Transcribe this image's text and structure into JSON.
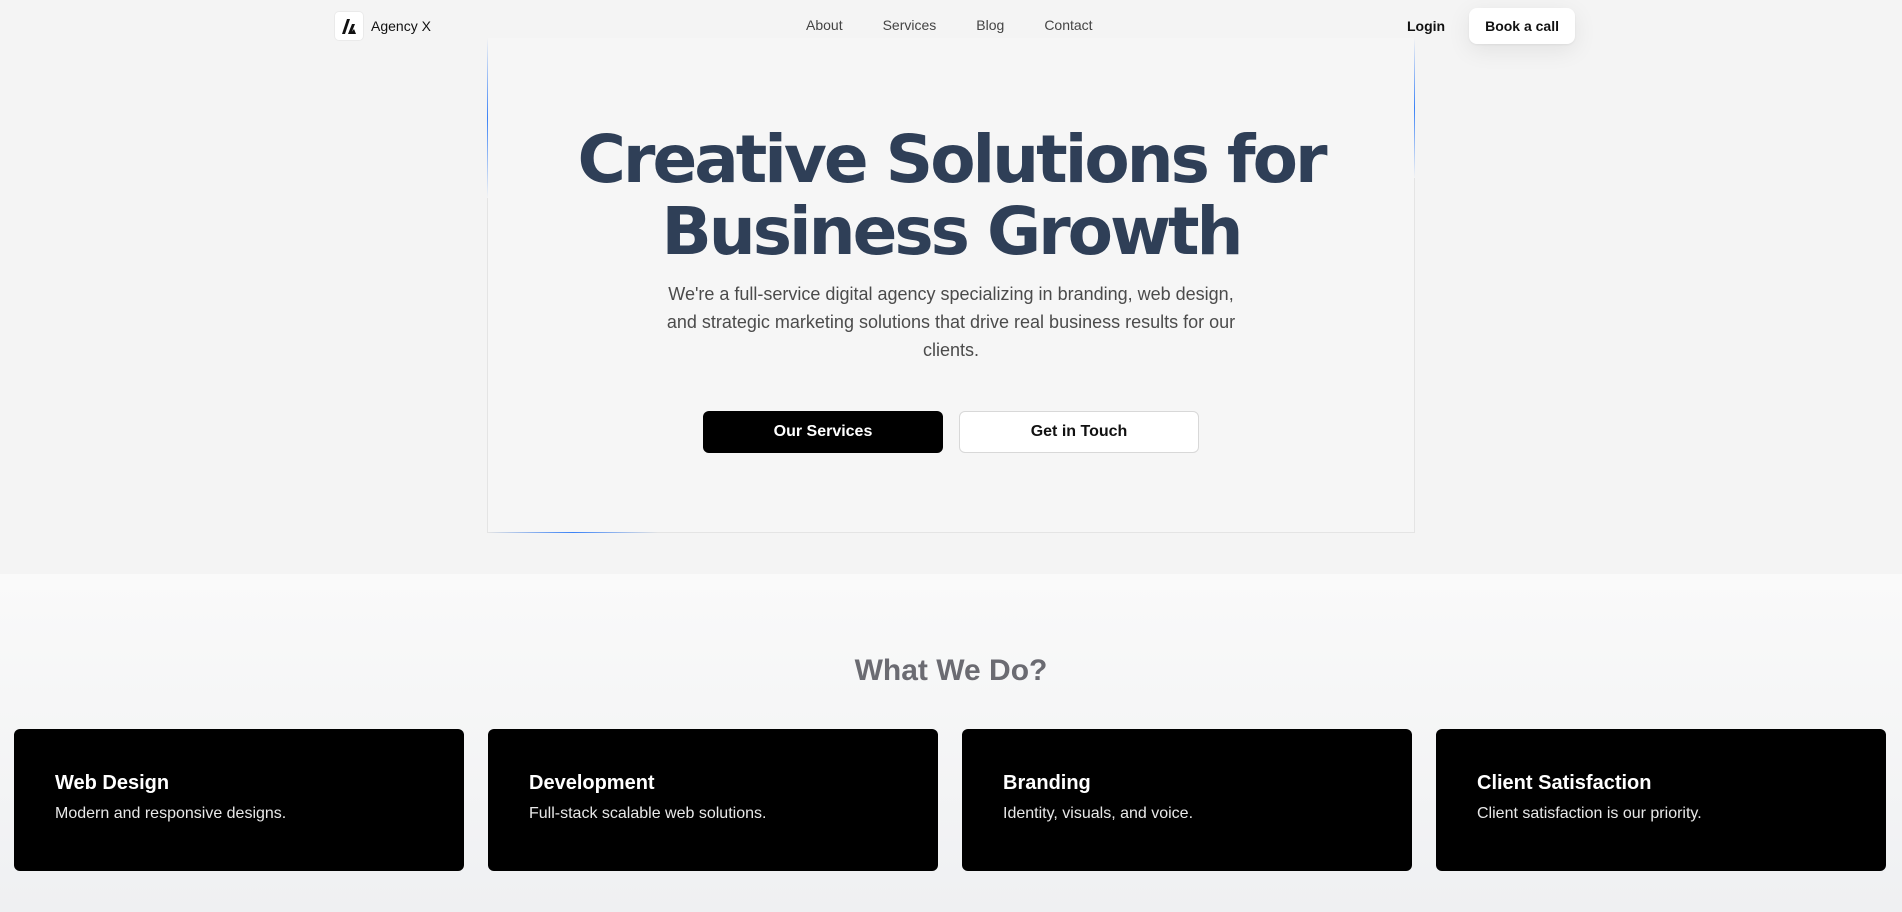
{
  "nav": {
    "brand_name": "Agency X",
    "links": [
      "About",
      "Services",
      "Blog",
      "Contact"
    ],
    "login": "Login",
    "cta": "Book a call"
  },
  "hero": {
    "title_line1": "Creative Solutions for",
    "title_line2": "Business Growth",
    "subtitle": "We're a full-service digital agency specializing in branding, web design, and strategic marketing solutions that drive real business results for our clients.",
    "primary_button": "Our Services",
    "secondary_button": "Get in Touch"
  },
  "services": {
    "title": "What We Do?",
    "cards": [
      {
        "title": "Web Design",
        "description": "Modern and responsive designs."
      },
      {
        "title": "Development",
        "description": "Full-stack scalable web solutions."
      },
      {
        "title": "Branding",
        "description": "Identity, visuals, and voice."
      },
      {
        "title": "Client Satisfaction",
        "description": "Client satisfaction is our priority."
      }
    ]
  },
  "colors": {
    "heading": "#2f3f57",
    "accent_line": "#3b82f6",
    "card_bg": "#000000"
  },
  "icons": {
    "brand_logo": "agency-logo-icon"
  }
}
